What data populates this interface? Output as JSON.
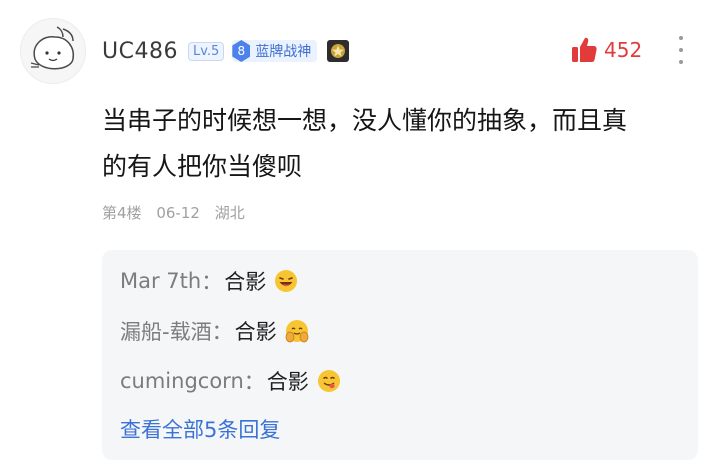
{
  "user": {
    "name": "UC486",
    "level": "Lv.5",
    "medal_num": "8",
    "medal_label": "蓝牌战神"
  },
  "likes": {
    "count": "452"
  },
  "comment": {
    "line1": "当串子的时候想一想，没人懂你的抽象，而且真",
    "line2": "的有人把你当傻呗"
  },
  "meta": {
    "floor": "第4楼",
    "date": "06-12",
    "location": "湖北"
  },
  "replies": [
    {
      "user": "Mar 7th",
      "sep": "：",
      "text": "合影",
      "emoji": "grinning-face-icon"
    },
    {
      "user": "漏船-载酒",
      "sep": "：",
      "text": "合影",
      "emoji": "face-with-hand-icon"
    },
    {
      "user": "cumingcorn",
      "sep": "：",
      "text": "合影",
      "emoji": "savoring-food-face-icon"
    }
  ],
  "view_all": "查看全部5条回复",
  "colors": {
    "accent": "#3b72d8",
    "like": "#e23b3b",
    "meta": "#a0a0a0"
  }
}
